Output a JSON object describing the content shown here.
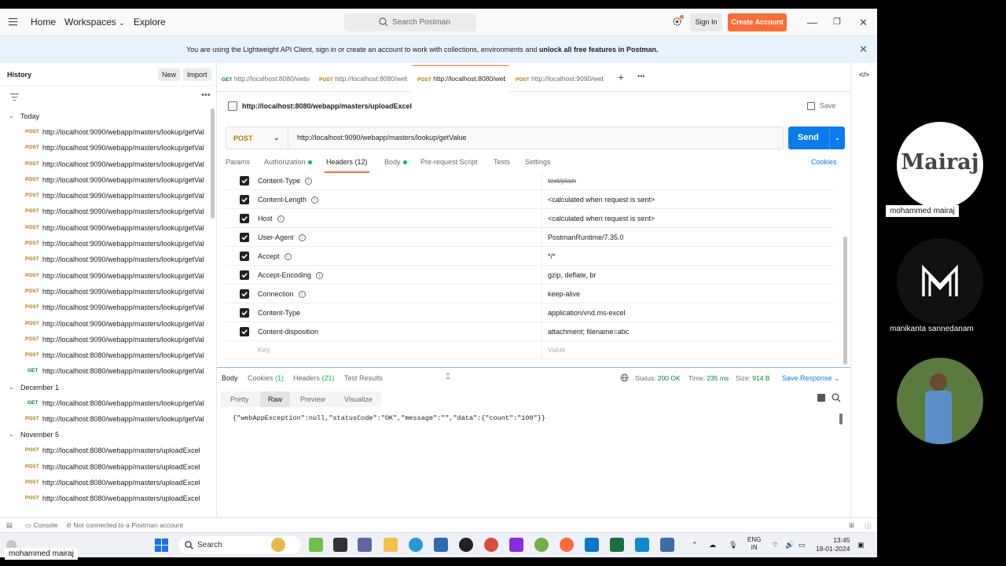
{
  "topbar": {
    "nav": [
      "Home",
      "Workspaces",
      "Explore"
    ],
    "search_placeholder": "Search Postman",
    "sign_in": "Sign In",
    "create_account": "Create Account"
  },
  "banner": {
    "text": "You are using the Lightweight API Client, sign in or create an account to work with collections, environments and ",
    "bold": "unlock all free features in Postman."
  },
  "sidebar": {
    "title": "History",
    "new": "New",
    "import": "Import",
    "groups": [
      {
        "label": "Today",
        "items": [
          {
            "method": "POST",
            "url": "http://localhost:9090/webapp/masters/lookup/getValue"
          },
          {
            "method": "POST",
            "url": "http://localhost:9090/webapp/masters/lookup/getValue"
          },
          {
            "method": "POST",
            "url": "http://localhost:9090/webapp/masters/lookup/getValue"
          },
          {
            "method": "POST",
            "url": "http://localhost:9090/webapp/masters/lookup/getValue"
          },
          {
            "method": "POST",
            "url": "http://localhost:9090/webapp/masters/lookup/getValue"
          },
          {
            "method": "POST",
            "url": "http://localhost:9090/webapp/masters/lookup/getValue"
          },
          {
            "method": "POST",
            "url": "http://localhost:9090/webapp/masters/lookup/getValue"
          },
          {
            "method": "POST",
            "url": "http://localhost:9090/webapp/masters/lookup/getValue"
          },
          {
            "method": "POST",
            "url": "http://localhost:9090/webapp/masters/lookup/getValue"
          },
          {
            "method": "POST",
            "url": "http://localhost:9090/webapp/masters/lookup/getValue"
          },
          {
            "method": "POST",
            "url": "http://localhost:9090/webapp/masters/lookup/getValue"
          },
          {
            "method": "POST",
            "url": "http://localhost:9090/webapp/masters/lookup/getValue"
          },
          {
            "method": "POST",
            "url": "http://localhost:9090/webapp/masters/lookup/getValue"
          },
          {
            "method": "POST",
            "url": "http://localhost:9090/webapp/masters/lookup/getValue"
          },
          {
            "method": "POST",
            "url": "http://localhost:8080/webapp/masters/lookup/getValue"
          },
          {
            "method": "GET",
            "url": "http://localhost:8080/webapp/masters/lookup/getValue"
          }
        ]
      },
      {
        "label": "December 1",
        "items": [
          {
            "method": "GET",
            "url": "http://localhost:8080/webapp/masters/lookup/getValue"
          },
          {
            "method": "POST",
            "url": "http://localhost:8080/webapp/masters/lookup/getValue"
          }
        ]
      },
      {
        "label": "November 5",
        "items": [
          {
            "method": "POST",
            "url": "http://localhost:8080/webapp/masters/uploadExcel"
          },
          {
            "method": "POST",
            "url": "http://localhost:8080/webapp/masters/uploadExcel"
          },
          {
            "method": "POST",
            "url": "http://localhost:8080/webapp/masters/uploadExcel"
          },
          {
            "method": "POST",
            "url": "http://localhost:8080/webapp/masters/uploadExcel"
          }
        ]
      }
    ]
  },
  "tabs": [
    {
      "method": "GET",
      "url": "http://localhost:8080/webapp"
    },
    {
      "method": "POST",
      "url": "http://localhost:8080/webapp"
    },
    {
      "method": "POST",
      "url": "http://localhost:8080/webapp",
      "active": true
    },
    {
      "method": "POST",
      "url": "http://localhost:9090/webapp"
    }
  ],
  "request": {
    "title": "http://localhost:8080/webapp/masters/uploadExcel",
    "save": "Save",
    "method": "POST",
    "url": "http://localhost:9090/webapp/masters/lookup/getValue",
    "send": "Send",
    "tabs": [
      "Params",
      "Authorization",
      "Headers (12)",
      "Body",
      "Pre-request Script",
      "Tests",
      "Settings"
    ],
    "cookies": "Cookies"
  },
  "headers": [
    {
      "key": "Content-Type",
      "value": "text/plain",
      "info": true,
      "strike": true
    },
    {
      "key": "Content-Length",
      "value": "<calculated when request is sent>",
      "info": true
    },
    {
      "key": "Host",
      "value": "<calculated when request is sent>",
      "info": true
    },
    {
      "key": "User-Agent",
      "value": "PostmanRuntime/7.35.0",
      "info": true
    },
    {
      "key": "Accept",
      "value": "*/*",
      "info": true
    },
    {
      "key": "Accept-Encoding",
      "value": "gzip, deflate, br",
      "info": true
    },
    {
      "key": "Connection",
      "value": "keep-alive",
      "info": true
    },
    {
      "key": "Content-Type",
      "value": "application/vnd.ms-excel",
      "info": false
    },
    {
      "key": "Content-disposition",
      "value": "attachment; filename=abc",
      "info": false
    }
  ],
  "header_placeholder": {
    "key": "Key",
    "value": "Value"
  },
  "response": {
    "tabs": [
      "Body",
      "Cookies",
      "(1)",
      "Headers",
      "(21)",
      "Test Results"
    ],
    "status_label": "Status:",
    "status": "200 OK",
    "time_label": "Time:",
    "time": "235 ms",
    "size_label": "Size:",
    "size": "914 B",
    "save_response": "Save Response",
    "formats": [
      "Pretty",
      "Raw",
      "Preview",
      "Visualize"
    ],
    "body": "{\"webAppException\":null,\"statusCode\":\"OK\",\"message\":\"\",\"data\":{\"count\":\"100\"}}"
  },
  "statusbar": {
    "console": "Console",
    "account": "Not connected to a Postman account"
  },
  "taskbar": {
    "search": "Search",
    "lang1": "ENG",
    "lang2": "IN",
    "time": "13:45",
    "date": "18-01-2024"
  },
  "participants": [
    {
      "name": "mohammed mairaj",
      "logo_text": "Mairaj"
    },
    {
      "name": "manikanta sannedanam"
    },
    {
      "name": ""
    }
  ],
  "self_name": "mohammed mairaj",
  "colors": {
    "accent": "#ff6c37",
    "send": "#097bed",
    "post": "#ad7a03",
    "get": "#007f31"
  }
}
